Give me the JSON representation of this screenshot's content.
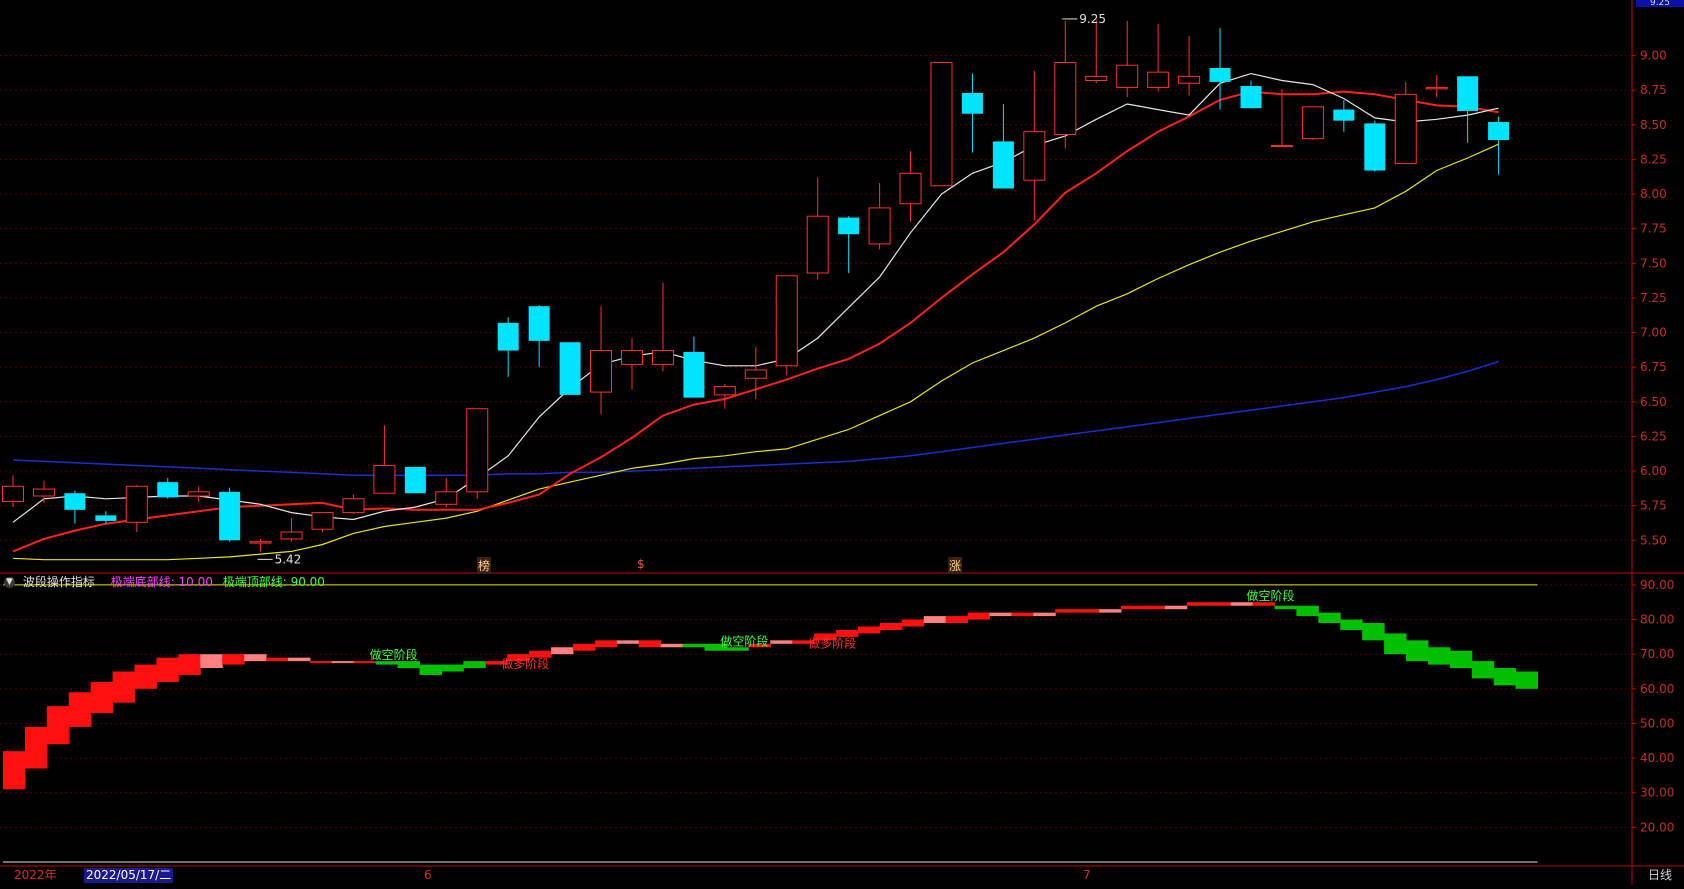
{
  "indicator_header": {
    "icon": "chevron-down-icon",
    "name": "波段操作指标",
    "bottom_line_label": "极端底部线: 10.00",
    "top_line_label": "极端顶部线: 90.00"
  },
  "time_bar": {
    "year_label": "2022年",
    "cursor_date": "2022/05/17/二",
    "month_6": "6",
    "month_7": "7",
    "period": "日线"
  },
  "top_price_box": "9.25",
  "markers": {
    "m1": "榜",
    "m2": "$",
    "m3": "涨"
  },
  "colors": {
    "up": "#ff3030",
    "down": "#00e5ff",
    "ma5": "#e6e6e6",
    "ma10": "#ff2020",
    "ma20": "#e6e600",
    "ma60": "#1a2ed0",
    "grid": "#5a0000",
    "axis": "#c00000",
    "red_block": "#ff1010",
    "pink_block": "#ff8080",
    "green_block": "#00c000"
  },
  "chart_data": [
    {
      "type": "candlestick",
      "y_ticks": [
        "9.00",
        "8.75",
        "8.50",
        "8.25",
        "8.00",
        "7.75",
        "7.50",
        "7.25",
        "7.00",
        "6.75",
        "6.50",
        "6.25",
        "6.00",
        "5.75",
        "5.50"
      ],
      "ylim": [
        5.3,
        9.3
      ],
      "annotations": [
        {
          "text": "5.42",
          "x": 8,
          "y": 5.42
        },
        {
          "text": "9.25",
          "x": 34,
          "y": 9.25
        }
      ],
      "ohlc": [
        [
          5.78,
          5.97,
          5.74,
          5.89
        ],
        [
          5.82,
          5.93,
          5.77,
          5.87
        ],
        [
          5.84,
          5.86,
          5.62,
          5.72
        ],
        [
          5.68,
          5.71,
          5.62,
          5.64
        ],
        [
          5.63,
          5.9,
          5.56,
          5.89
        ],
        [
          5.92,
          5.95,
          5.8,
          5.81
        ],
        [
          5.82,
          5.89,
          5.78,
          5.85
        ],
        [
          5.85,
          5.88,
          5.49,
          5.5
        ],
        [
          5.48,
          5.51,
          5.42,
          5.49
        ],
        [
          5.51,
          5.66,
          5.49,
          5.56
        ],
        [
          5.58,
          5.7,
          5.56,
          5.7
        ],
        [
          5.7,
          5.83,
          5.69,
          5.8
        ],
        [
          5.84,
          6.33,
          5.84,
          6.04
        ],
        [
          6.03,
          6.03,
          5.84,
          5.84
        ],
        [
          5.76,
          5.95,
          5.74,
          5.85
        ],
        [
          5.85,
          6.45,
          5.8,
          6.45
        ],
        [
          7.07,
          7.11,
          6.68,
          6.87
        ],
        [
          7.19,
          7.2,
          6.75,
          6.94
        ],
        [
          6.93,
          6.92,
          6.58,
          6.55
        ],
        [
          6.57,
          7.19,
          6.41,
          6.87
        ],
        [
          6.77,
          6.96,
          6.59,
          6.87
        ],
        [
          6.77,
          7.36,
          6.72,
          6.87
        ],
        [
          6.86,
          6.97,
          6.55,
          6.53
        ],
        [
          6.55,
          6.63,
          6.45,
          6.61
        ],
        [
          6.67,
          6.9,
          6.52,
          6.73
        ],
        [
          6.76,
          7.41,
          6.69,
          7.41
        ],
        [
          7.43,
          8.12,
          7.38,
          7.84
        ],
        [
          7.83,
          7.84,
          7.43,
          7.71
        ],
        [
          7.64,
          8.08,
          7.6,
          7.9
        ],
        [
          7.93,
          8.31,
          7.8,
          8.15
        ],
        [
          8.06,
          8.95,
          8.06,
          8.95
        ],
        [
          8.73,
          8.87,
          8.3,
          8.58
        ],
        [
          8.38,
          8.65,
          8.07,
          8.04
        ],
        [
          8.1,
          8.89,
          7.81,
          8.45
        ],
        [
          8.43,
          9.25,
          8.33,
          8.95
        ],
        [
          8.82,
          9.26,
          8.8,
          8.85
        ],
        [
          8.77,
          9.25,
          8.7,
          8.93
        ],
        [
          8.77,
          9.23,
          8.74,
          8.88
        ],
        [
          8.8,
          9.14,
          8.71,
          8.85
        ],
        [
          8.91,
          9.2,
          8.61,
          8.81
        ],
        [
          8.78,
          8.82,
          8.62,
          8.62
        ],
        [
          8.35,
          8.76,
          8.35,
          8.35
        ],
        [
          8.4,
          8.63,
          8.39,
          8.63
        ],
        [
          8.61,
          8.68,
          8.45,
          8.53
        ],
        [
          8.51,
          8.53,
          8.16,
          8.17
        ],
        [
          8.22,
          8.81,
          8.22,
          8.72
        ],
        [
          8.76,
          8.86,
          8.7,
          8.77
        ],
        [
          8.85,
          8.85,
          8.37,
          8.6
        ],
        [
          8.52,
          8.56,
          8.14,
          8.39
        ]
      ],
      "ma5": [
        5.63,
        5.8,
        5.82,
        5.8,
        5.81,
        5.82,
        5.82,
        5.79,
        5.76,
        5.7,
        5.67,
        5.65,
        5.71,
        5.74,
        5.8,
        5.95,
        6.11,
        6.39,
        6.6,
        6.77,
        6.83,
        6.86,
        6.8,
        6.76,
        6.76,
        6.81,
        6.96,
        7.18,
        7.4,
        7.72,
        8.0,
        8.15,
        8.23,
        8.35,
        8.42,
        8.54,
        8.65,
        8.61,
        8.57,
        8.8,
        8.87,
        8.82,
        8.79,
        8.69,
        8.55,
        8.52,
        8.54,
        8.57,
        8.62
      ],
      "ma10": [
        5.42,
        5.51,
        5.57,
        5.62,
        5.65,
        5.68,
        5.71,
        5.74,
        5.75,
        5.76,
        5.77,
        5.72,
        5.73,
        5.72,
        5.72,
        5.72,
        5.77,
        5.83,
        5.98,
        6.1,
        6.24,
        6.4,
        6.48,
        6.52,
        6.59,
        6.66,
        6.74,
        6.81,
        6.92,
        7.07,
        7.25,
        7.42,
        7.58,
        7.78,
        8.01,
        8.15,
        8.31,
        8.45,
        8.56,
        8.68,
        8.74,
        8.72,
        8.72,
        8.74,
        8.72,
        8.68,
        8.64,
        8.63,
        8.59
      ],
      "ma20": [
        5.37,
        5.36,
        5.36,
        5.36,
        5.36,
        5.36,
        5.37,
        5.38,
        5.4,
        5.42,
        5.47,
        5.55,
        5.6,
        5.63,
        5.66,
        5.71,
        5.79,
        5.87,
        5.92,
        5.97,
        6.02,
        6.05,
        6.09,
        6.11,
        6.14,
        6.16,
        6.23,
        6.3,
        6.4,
        6.5,
        6.65,
        6.78,
        6.87,
        6.96,
        7.07,
        7.19,
        7.28,
        7.39,
        7.49,
        7.58,
        7.66,
        7.73,
        7.8,
        7.85,
        7.9,
        8.02,
        8.17,
        8.26,
        8.36,
        8.44,
        8.51,
        8.57,
        8.59,
        8.59
      ],
      "ma60": [
        6.08,
        6.07,
        6.06,
        6.05,
        6.04,
        6.03,
        6.02,
        6.01,
        6.0,
        5.99,
        5.98,
        5.97,
        5.97,
        5.97,
        5.97,
        5.97,
        5.98,
        5.98,
        5.99,
        5.99,
        6.0,
        6.01,
        6.02,
        6.03,
        6.04,
        6.05,
        6.06,
        6.07,
        6.09,
        6.11,
        6.14,
        6.17,
        6.2,
        6.23,
        6.26,
        6.29,
        6.32,
        6.35,
        6.38,
        6.41,
        6.44,
        6.47,
        6.5,
        6.53,
        6.57,
        6.61,
        6.66,
        6.72,
        6.79
      ]
    },
    {
      "type": "bar",
      "title": "波段操作指标",
      "y_ticks": [
        "90.00",
        "80.00",
        "70.00",
        "60.00",
        "50.00",
        "40.00",
        "30.00",
        "20.00"
      ],
      "ylim": [
        10,
        92
      ],
      "reference_lines": {
        "bottom": 10,
        "top": 90
      },
      "annotations": [
        {
          "text": "做空阶段",
          "x": 12
        },
        {
          "text": "做多阶段",
          "x": 16
        },
        {
          "text": "做空阶段",
          "x": 23
        },
        {
          "text": "做多阶段",
          "x": 26
        },
        {
          "text": "做空阶段",
          "x": 40
        }
      ],
      "blocks": [
        [
          31,
          42,
          "red"
        ],
        [
          37,
          49,
          "red"
        ],
        [
          44,
          55,
          "red"
        ],
        [
          49,
          59,
          "red"
        ],
        [
          53,
          62,
          "red"
        ],
        [
          56,
          65,
          "red"
        ],
        [
          60,
          67,
          "red"
        ],
        [
          62,
          69,
          "red"
        ],
        [
          64,
          70,
          "red"
        ],
        [
          66,
          70,
          "pink"
        ],
        [
          67,
          70,
          "red"
        ],
        [
          68,
          70,
          "pink"
        ],
        [
          68,
          69,
          "red"
        ],
        [
          68,
          69,
          "pink"
        ],
        [
          68,
          68,
          "red"
        ],
        [
          68,
          68,
          "pink"
        ],
        [
          68,
          68,
          "red"
        ],
        [
          67,
          68,
          "green"
        ],
        [
          66,
          68,
          "green"
        ],
        [
          64,
          67,
          "green"
        ],
        [
          65,
          67,
          "green"
        ],
        [
          66,
          68,
          "green"
        ],
        [
          67,
          68,
          "red"
        ],
        [
          68,
          70,
          "red"
        ],
        [
          69,
          71,
          "red"
        ],
        [
          70,
          72,
          "pink"
        ],
        [
          71,
          73,
          "red"
        ],
        [
          72,
          74,
          "red"
        ],
        [
          73,
          74,
          "pink"
        ],
        [
          72,
          74,
          "red"
        ],
        [
          72,
          73,
          "pink"
        ],
        [
          72,
          73,
          "green"
        ],
        [
          71,
          73,
          "green"
        ],
        [
          71,
          72,
          "green"
        ],
        [
          72,
          73,
          "red"
        ],
        [
          73,
          74,
          "pink"
        ],
        [
          73,
          74,
          "red"
        ],
        [
          74,
          76,
          "red"
        ],
        [
          75,
          77,
          "red"
        ],
        [
          76,
          78,
          "red"
        ],
        [
          77,
          79,
          "red"
        ],
        [
          78,
          80,
          "red"
        ],
        [
          79,
          81,
          "pink"
        ],
        [
          79,
          81,
          "red"
        ],
        [
          80,
          82,
          "red"
        ],
        [
          81,
          82,
          "pink"
        ],
        [
          81,
          82,
          "red"
        ],
        [
          81,
          82,
          "pink"
        ],
        [
          82,
          83,
          "red"
        ],
        [
          82,
          83,
          "red"
        ],
        [
          82,
          83,
          "pink"
        ],
        [
          83,
          84,
          "red"
        ],
        [
          83,
          84,
          "red"
        ],
        [
          83,
          84,
          "pink"
        ],
        [
          84,
          85,
          "red"
        ],
        [
          84,
          85,
          "red"
        ],
        [
          84,
          85,
          "pink"
        ],
        [
          84,
          85,
          "red"
        ],
        [
          83,
          84,
          "green"
        ],
        [
          81,
          84,
          "green"
        ],
        [
          79,
          82,
          "green"
        ],
        [
          77,
          80,
          "green"
        ],
        [
          74,
          79,
          "green"
        ],
        [
          70,
          76,
          "green"
        ],
        [
          68,
          74,
          "green"
        ],
        [
          67,
          72,
          "green"
        ],
        [
          66,
          71,
          "green"
        ],
        [
          63,
          68,
          "green"
        ],
        [
          61,
          66,
          "green"
        ],
        [
          60,
          65,
          "green"
        ]
      ]
    }
  ]
}
